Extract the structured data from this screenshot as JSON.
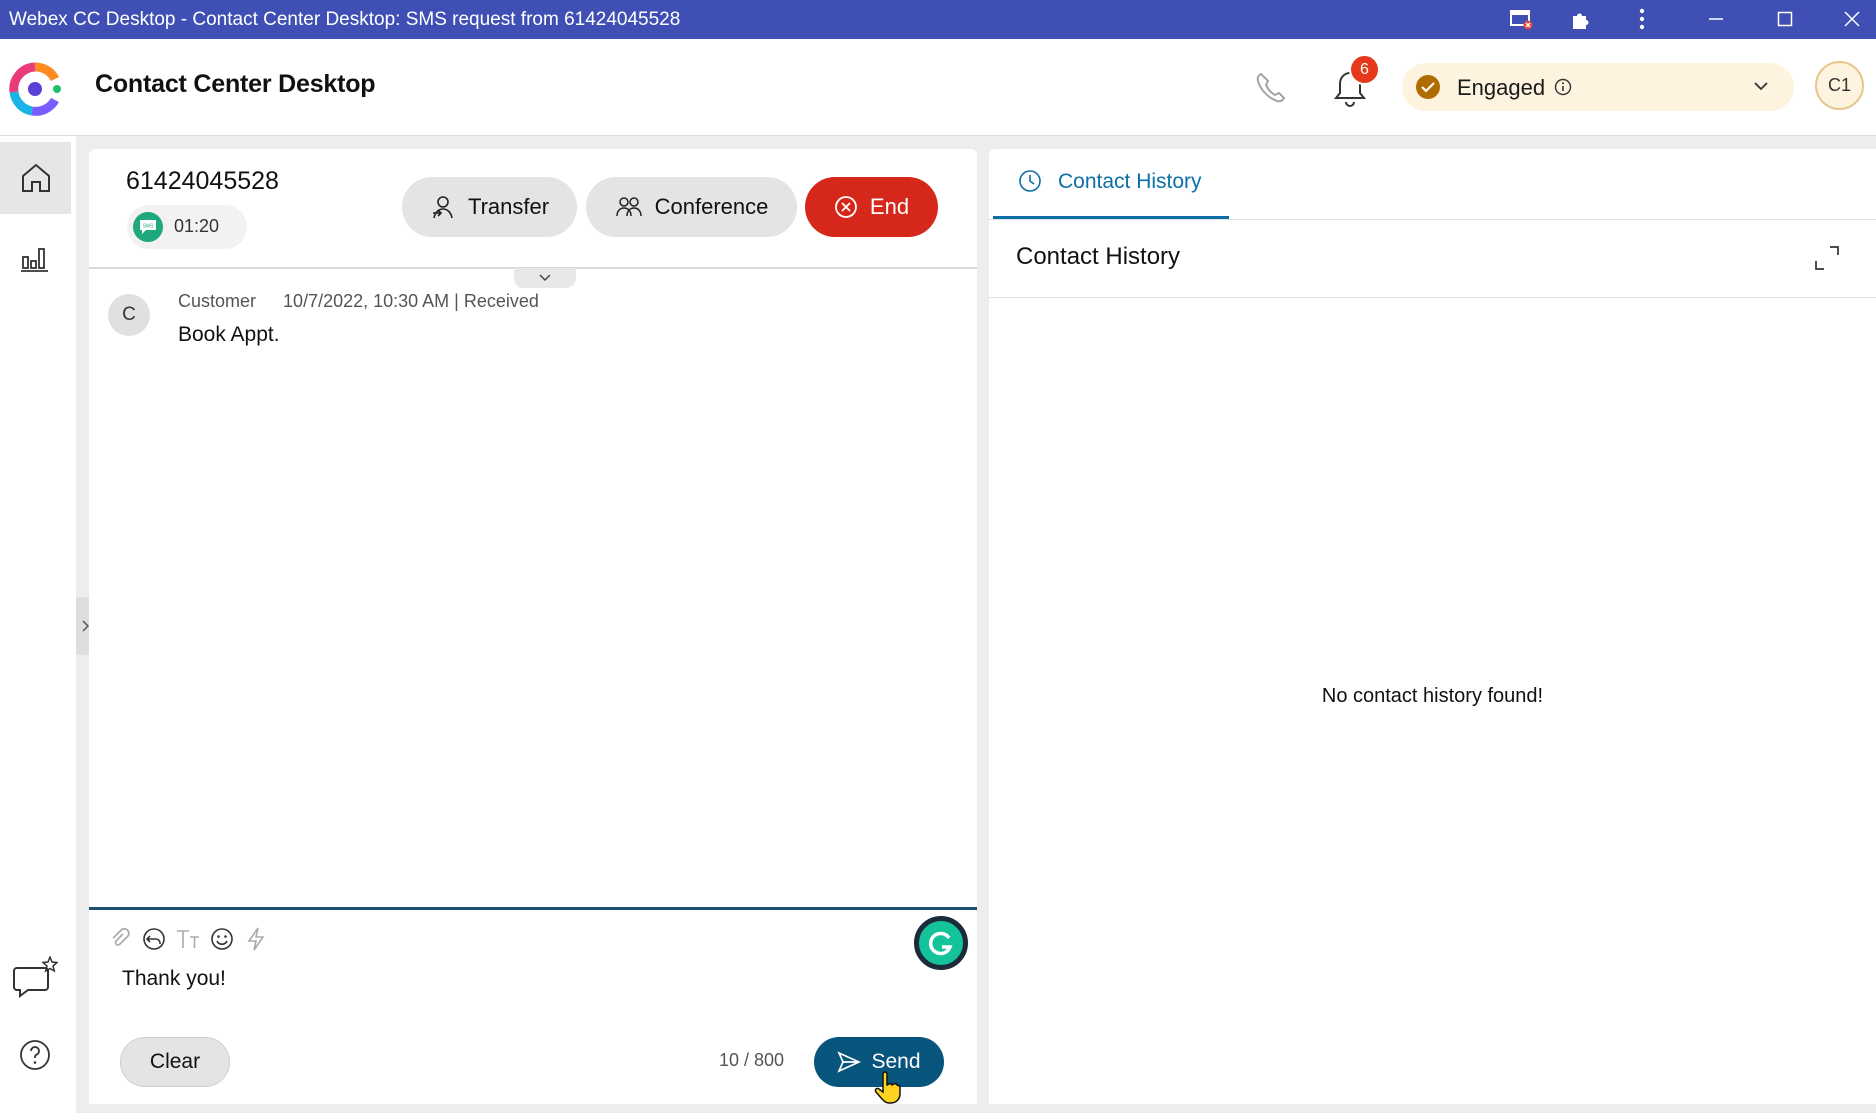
{
  "window": {
    "title": "Webex CC Desktop - Contact Center Desktop: SMS request from 61424045528",
    "controls": [
      "cast-icon",
      "extensions-icon",
      "more-vertical-icon",
      "minimize-icon",
      "maximize-icon",
      "close-icon"
    ]
  },
  "header": {
    "app_title": "Contact Center Desktop",
    "notifications_count": "6",
    "status_label": "Engaged",
    "avatar_initials": "C1"
  },
  "interaction": {
    "ani": "61424045528",
    "timer": "01:20",
    "channel_badge": "SMS",
    "buttons": {
      "transfer": "Transfer",
      "conference": "Conference",
      "end": "End"
    }
  },
  "messages": [
    {
      "avatar": "C",
      "sender": "Customer",
      "meta": "10/7/2022, 10:30 AM | Received",
      "text": "Book Appt."
    }
  ],
  "composer": {
    "text": "Thank you!",
    "char_count": "10 / 800",
    "clear_label": "Clear",
    "send_label": "Send",
    "toolbar_icons": [
      "attachment-icon",
      "reply-templates-icon",
      "text-format-icon",
      "emoji-icon",
      "quick-actions-icon"
    ]
  },
  "contact_history": {
    "tab_label": "Contact History",
    "title": "Contact History",
    "empty_message": "No contact history found!"
  },
  "colors": {
    "titlebar": "#3f4fb4",
    "end_button": "#d5271a",
    "send_button": "#07547c",
    "tab_accent": "#0e6ea8",
    "status_pill": "#fdf3df",
    "status_check": "#b06c00",
    "sms_badge": "#1fa77d",
    "grammarly": "#15c39a"
  }
}
